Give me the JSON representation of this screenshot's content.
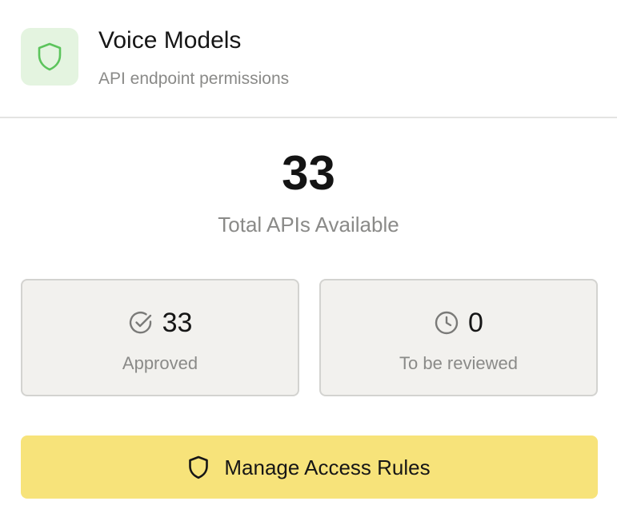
{
  "header": {
    "title": "Voice Models",
    "subtitle": "API endpoint permissions",
    "icon": "shield-icon",
    "icon_color": "#5cc45c",
    "icon_bg": "#e4f4e0"
  },
  "summary": {
    "total_value": "33",
    "total_label": "Total APIs Available"
  },
  "stats": [
    {
      "icon": "check-circle-icon",
      "value": "33",
      "label": "Approved"
    },
    {
      "icon": "clock-icon",
      "value": "0",
      "label": "To be reviewed"
    }
  ],
  "action": {
    "icon": "shield-icon",
    "label": "Manage Access Rules",
    "bg_color": "#f7e37a"
  }
}
